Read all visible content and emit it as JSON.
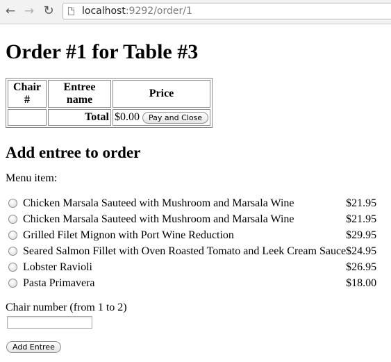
{
  "browser": {
    "url_host": "localhost",
    "url_rest": ":9292/order/1",
    "icons": [
      "back-icon",
      "forward-icon",
      "reload-icon",
      "page-icon"
    ]
  },
  "page": {
    "title": "Order #1 for Table #3",
    "order_table": {
      "headers": [
        "Chair #",
        "Entree name",
        "Price"
      ],
      "total_label": "Total",
      "total_value": "$0.00",
      "pay_close_label": "Pay and Close"
    },
    "add_section_title": "Add entree to order",
    "menu_label": "Menu item:",
    "menu_items": [
      {
        "name": "Chicken Marsala Sauteed with Mushroom and Marsala Wine",
        "price": "$21.95"
      },
      {
        "name": "Chicken Marsala Sauteed with Mushroom and Marsala Wine",
        "price": "$21.95"
      },
      {
        "name": "Grilled Filet Mignon with Port Wine Reduction",
        "price": "$29.95"
      },
      {
        "name": "Seared Salmon Fillet with Oven Roasted Tomato and Leek Cream Sauce",
        "price": "$24.95"
      },
      {
        "name": "Lobster Ravioli",
        "price": "$26.95"
      },
      {
        "name": "Pasta Primavera",
        "price": "$18.00"
      }
    ],
    "chair_label": "Chair number (from 1 to 2)",
    "chair_value": "",
    "add_button_label": "Add Entree"
  }
}
